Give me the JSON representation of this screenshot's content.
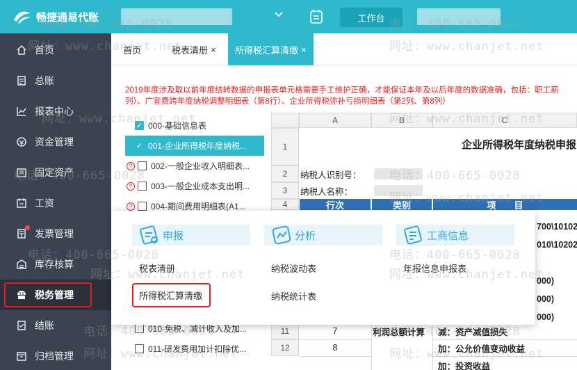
{
  "app": {
    "brand": "畅捷通易代账"
  },
  "topbar": {
    "workbench_label": "工作台"
  },
  "tabs": [
    {
      "label": "首页",
      "closable": false
    },
    {
      "label": "税表清册",
      "closable": true
    },
    {
      "label": "所得税汇算清缴",
      "closable": true,
      "active": true
    }
  ],
  "tab_close_glyph": "×",
  "sidebar": {
    "items": [
      {
        "label": "首页",
        "icon": "home-icon"
      },
      {
        "label": "总账",
        "icon": "ledger-icon"
      },
      {
        "label": "报表中心",
        "icon": "chart-icon"
      },
      {
        "label": "资金管理",
        "icon": "wallet-icon"
      },
      {
        "label": "固定资产",
        "icon": "asset-icon"
      },
      {
        "label": "工资",
        "icon": "salary-icon"
      },
      {
        "label": "发票管理",
        "icon": "invoice-icon",
        "badge": true
      },
      {
        "label": "库存核算",
        "icon": "inventory-icon"
      },
      {
        "label": "税务管理",
        "icon": "tax-icon",
        "active": true
      },
      {
        "label": "结账",
        "icon": "checkout-icon"
      },
      {
        "label": "归档管理",
        "icon": "archive-icon"
      }
    ]
  },
  "notice": {
    "line1": "2019年度涉及取以前年度结转数据的申报表单元格需要手工维护正确，才能保证本年及以后年度的数据准确，包括：职工薪",
    "line2": "列）、广宣费跨年度纳税调整明细表（第8行）、企业所得税弥补亏损明细表（第2列、第8列）"
  },
  "tree": [
    {
      "label": "000-基础信息表",
      "checked": true,
      "help": false
    },
    {
      "label": "001-企业所得税年度纳税...",
      "checked": true,
      "help": false,
      "selected": true
    },
    {
      "label": "002-一般企业收入明细表...",
      "checked": false,
      "help": true
    },
    {
      "label": "003-一般企业成本支出明...",
      "checked": false,
      "help": true
    },
    {
      "label": "004-期间费用明细表(A1...",
      "checked": false,
      "help": true
    },
    {
      "label": "010-免税、减计收入及加...",
      "checked": false,
      "help": false
    },
    {
      "label": "011-研发费用加计扣除优...",
      "checked": false,
      "help": false
    }
  ],
  "sheet": {
    "columns": [
      "A",
      "B",
      "C"
    ],
    "rows": [
      "1",
      "2",
      "3",
      "4",
      "11",
      "12"
    ],
    "title": "企业所得税年度纳税申报",
    "taxpayer_id_label": "纳税人识别号：",
    "taxpayer_name_label": "纳税人名称：",
    "header_row": {
      "a": "行次",
      "b": "类别",
      "c": "项　　目"
    },
    "snippets": [
      "700\\101020\\",
      "010\\10202",
      "000)",
      "000)",
      "000)"
    ],
    "row11": {
      "a": "7",
      "b": "利润总额计算",
      "c": "减：资产减值损失"
    },
    "row12": {
      "a": "8",
      "c": "加：公允价值变动收益"
    },
    "row13_c": "加：投资收益"
  },
  "popup": {
    "sections": [
      {
        "title": "申报",
        "icon": "declare-icon",
        "links": [
          "税表清册",
          "所得税汇算清缴"
        ]
      },
      {
        "title": "分析",
        "icon": "analysis-icon",
        "links": [
          "纳税波动表",
          "纳税统计表"
        ]
      },
      {
        "title": "工商信息",
        "icon": "business-icon",
        "links": [
          "年报信息申报表"
        ]
      }
    ]
  },
  "watermark": {
    "phone": "电话：400-665-0028",
    "site": "网址：www.chanjet.net"
  }
}
